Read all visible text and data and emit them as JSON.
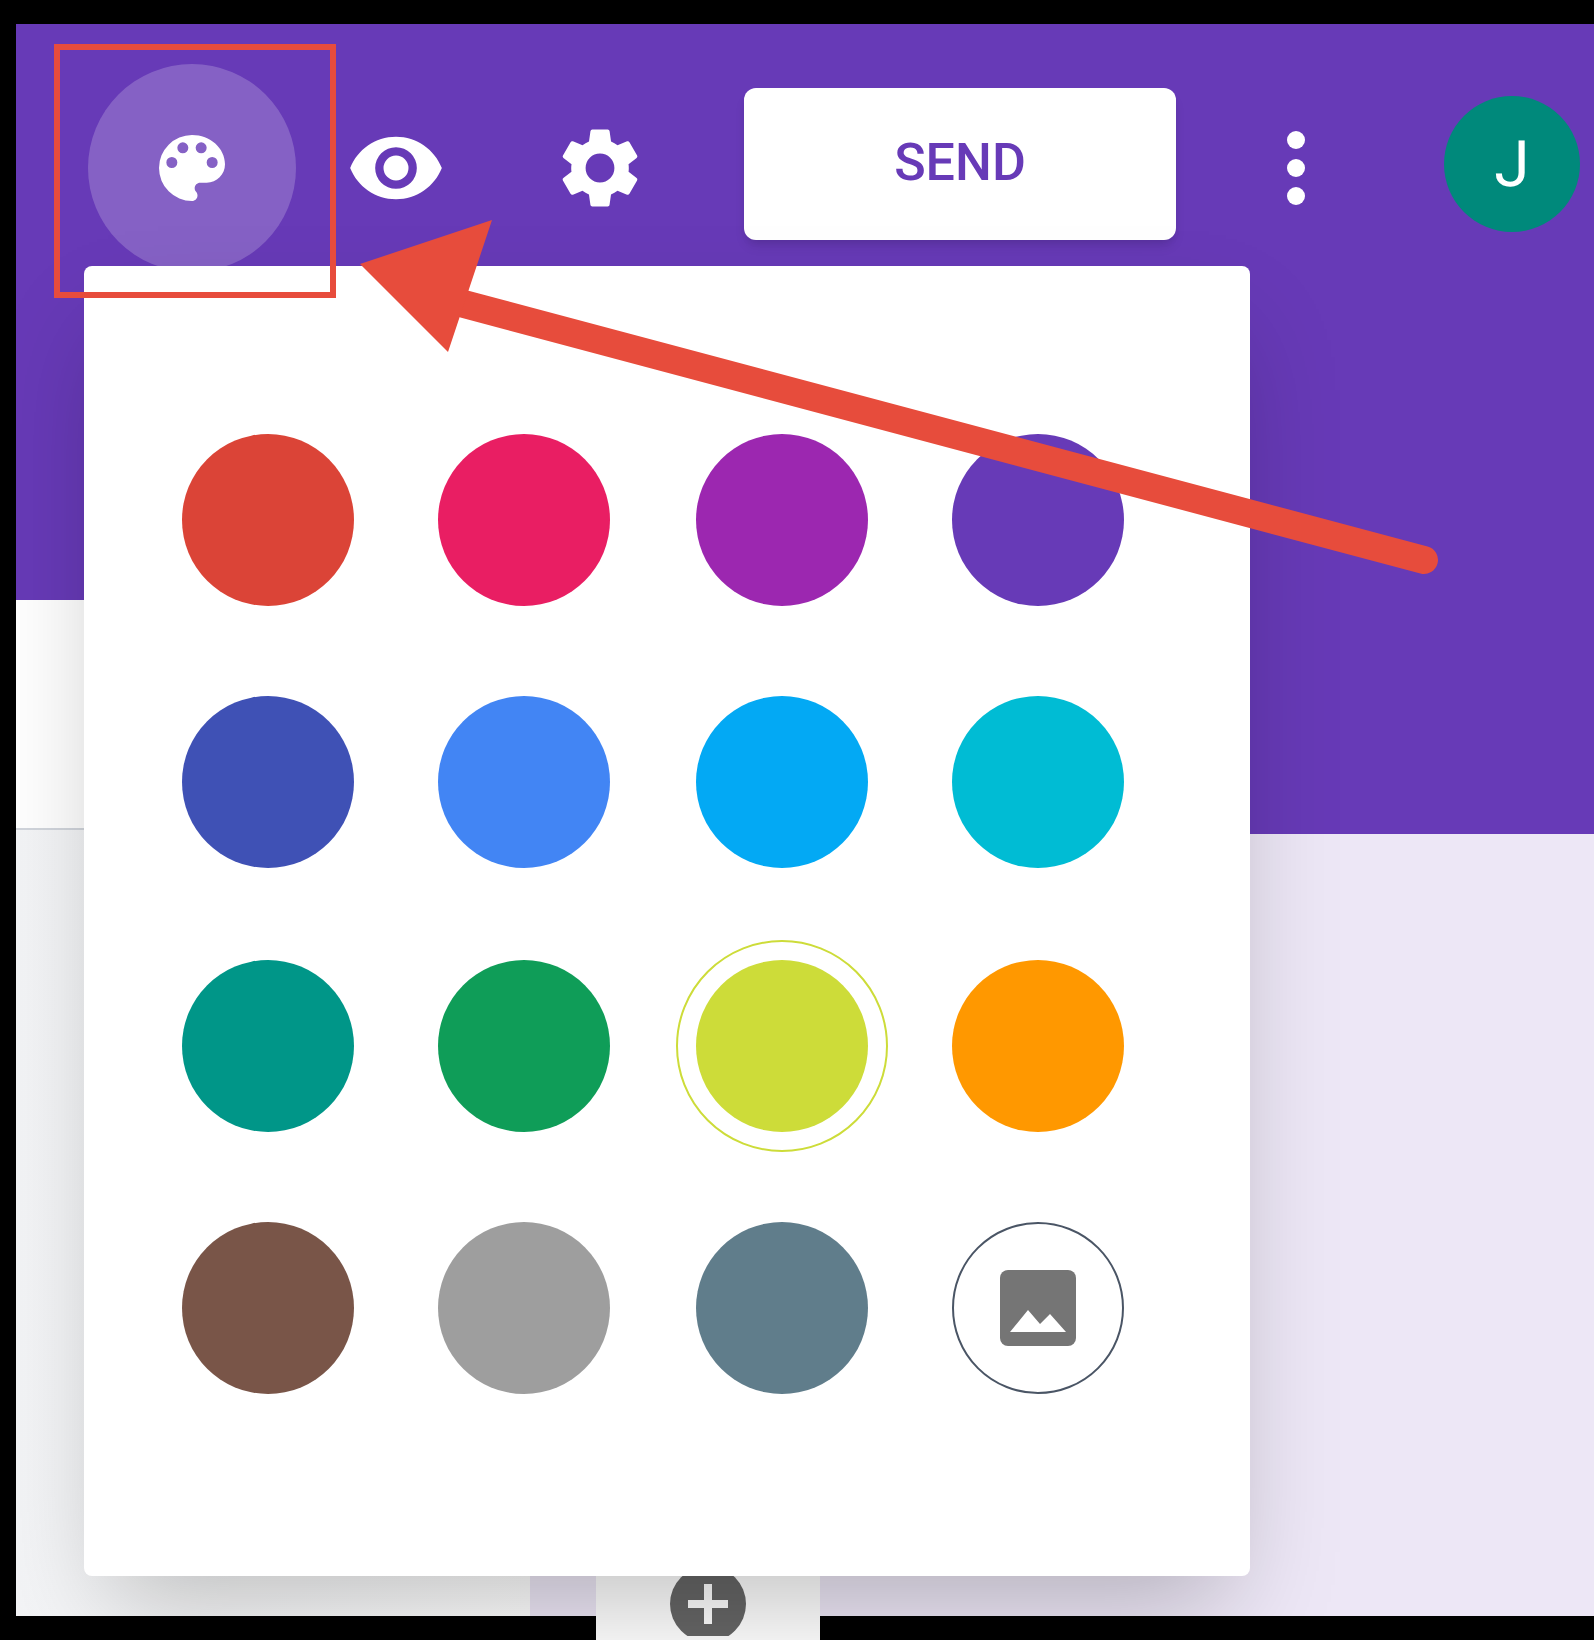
{
  "toolbar": {
    "send_button": {
      "label": "SEND"
    },
    "avatar": {
      "initial": "J",
      "color": "#00897b"
    }
  },
  "theme_palette": {
    "swatches": [
      {
        "kind": "color",
        "color": "#db4437",
        "selected": false
      },
      {
        "kind": "color",
        "color": "#e91e63",
        "selected": false
      },
      {
        "kind": "color",
        "color": "#9c27b0",
        "selected": false
      },
      {
        "kind": "color",
        "color": "#673ab7",
        "selected": false
      },
      {
        "kind": "color",
        "color": "#3f51b5",
        "selected": false
      },
      {
        "kind": "color",
        "color": "#4285f4",
        "selected": false
      },
      {
        "kind": "color",
        "color": "#03a9f4",
        "selected": false
      },
      {
        "kind": "color",
        "color": "#00bcd4",
        "selected": false
      },
      {
        "kind": "color",
        "color": "#009688",
        "selected": false
      },
      {
        "kind": "color",
        "color": "#0f9d58",
        "selected": false
      },
      {
        "kind": "color",
        "color": "#cddc39",
        "selected": true
      },
      {
        "kind": "color",
        "color": "#ff9800",
        "selected": false
      },
      {
        "kind": "color",
        "color": "#795548",
        "selected": false
      },
      {
        "kind": "color",
        "color": "#9e9e9e",
        "selected": false
      },
      {
        "kind": "color",
        "color": "#607d8b",
        "selected": false
      },
      {
        "kind": "image",
        "selected": false
      }
    ]
  }
}
